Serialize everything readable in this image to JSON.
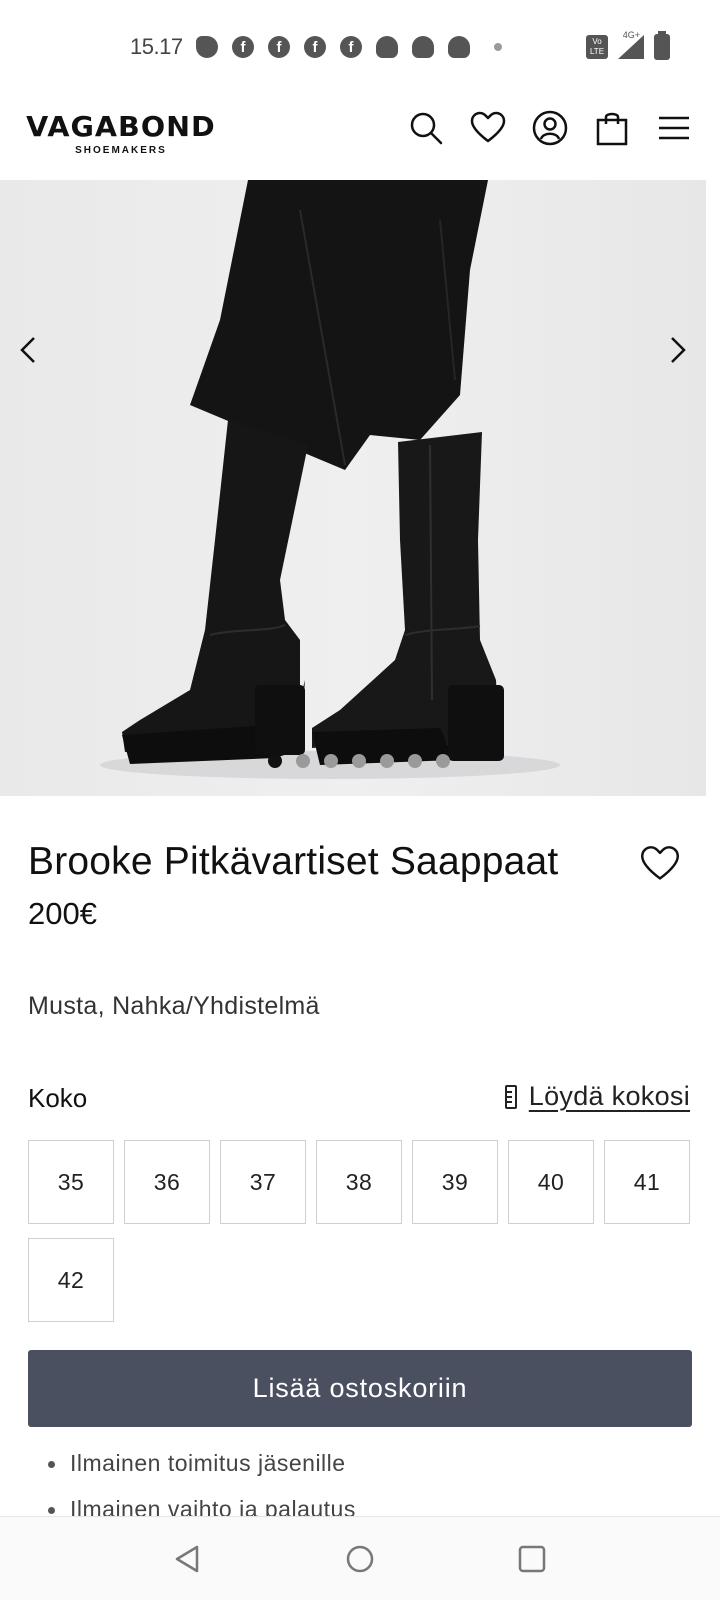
{
  "status_bar": {
    "time": "15.17",
    "notifications": [
      "messages-icon",
      "facebook-icon",
      "facebook-icon",
      "facebook-icon",
      "facebook-icon",
      "snapchat-icon",
      "snapchat-icon",
      "snapchat-icon",
      "more-dot-icon"
    ],
    "lte_label": "Vo LTE",
    "network_label": "4G+"
  },
  "header": {
    "logo_main": "VAGABOND",
    "logo_sub": "SHOEMAKERS",
    "icons": [
      "search-icon",
      "heart-icon",
      "account-icon",
      "bag-icon",
      "menu-icon"
    ]
  },
  "gallery": {
    "image_count": 7,
    "active_index": 0
  },
  "product": {
    "title": "Brooke Pitkävartiset Saappaat",
    "price": "200€",
    "variant": "Musta, Nahka/Yhdistelmä"
  },
  "size_selector": {
    "label": "Koko",
    "find_size_label": "Löydä kokosi",
    "sizes": [
      "35",
      "36",
      "37",
      "38",
      "39",
      "40",
      "41",
      "42"
    ]
  },
  "cart": {
    "button_label": "Lisää ostoskoriin"
  },
  "benefits": [
    "Ilmainen toimitus jäsenille",
    "Ilmainen vaihto ja palautus"
  ],
  "colors": {
    "cart_button": "#4a5060",
    "text": "#111111",
    "size_border": "#d0d0d0"
  }
}
